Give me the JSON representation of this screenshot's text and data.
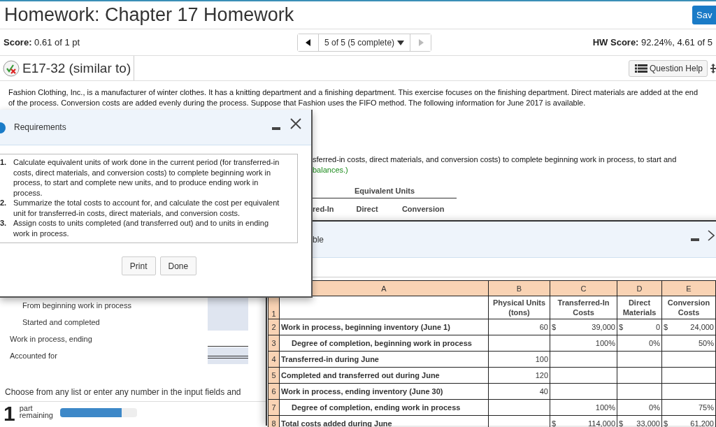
{
  "header": {
    "title": "Homework: Chapter 17 Homework",
    "save_label": "Sav"
  },
  "score_bar": {
    "score_label": "Score:",
    "score_value": "0.61 of 1 pt",
    "nav": {
      "label": "5 of 5 (5 complete)",
      "prev_disabled": false,
      "next_disabled": true
    },
    "hw_label": "HW Score:",
    "hw_value": "92.24%, 4.61 of 5"
  },
  "question_bar": {
    "title": "E17-32 (similar to)",
    "partial_credit": true,
    "help_label": "Question Help"
  },
  "problem_text": "Fashion Clothing, Inc., is a manufacturer of winter clothes. It has a knitting department and a finishing department. This exercise focuses on the finishing department. Direct materials are added at the end of the process. Conversion costs are added evenly during the process. Suppose that Fashion uses the FIFO method. The following information for June 2017 is available.",
  "instructions": {
    "text": "sferred-in costs, direct materials, and conversion costs) to complete beginning work in process, to start and",
    "hint": "balances.)"
  },
  "equivalent_units": {
    "title": "Equivalent Units",
    "columns": [
      "red-In",
      "Direct",
      "Conversion"
    ]
  },
  "worksheet_rows": [
    {
      "label": "From beginning work in process",
      "indent": true,
      "answer_cell": true,
      "underline": false,
      "double_underline": false
    },
    {
      "label": "Started and completed",
      "indent": true,
      "answer_cell": true,
      "underline": false,
      "double_underline": false
    },
    {
      "label": "Work in process, ending",
      "indent": false,
      "answer_cell": false,
      "underline": true,
      "double_underline": false
    },
    {
      "label": "Accounted for",
      "indent": false,
      "answer_cell": true,
      "underline": false,
      "double_underline": true
    }
  ],
  "footer": {
    "instruction": "Choose from any list or enter any number in the input fields and",
    "parts_count": "1",
    "parts_label": "part remaining",
    "progress": {
      "level": 0.8
    }
  },
  "requirements_dialog": {
    "title": "Requirements",
    "items": [
      {
        "number": "1.",
        "text": "Calculate equivalent units of work done in the current period (for transferred-in costs, direct materials, and conversion costs) to complete beginning work in process, to start and complete new units, and to produce ending work in process."
      },
      {
        "number": "2.",
        "text": "Summarize the total costs to account for, and calculate the cost per equivalent unit for transferred-in costs, direct materials, and conversion costs."
      },
      {
        "number": "3.",
        "text": "Assign costs to units completed (and transferred out) and to units in ending work in process."
      }
    ],
    "buttons": [
      "Print",
      "Done"
    ]
  },
  "data_dialog": {
    "title": "ble",
    "table": {
      "column_letters": [
        "A",
        "B",
        "C",
        "D",
        "E"
      ],
      "heading_row": {
        "number": "1",
        "headings": [
          "Physical Units (tons)",
          "Transferred-In Costs",
          "Direct Materials",
          "Conversion Costs"
        ]
      },
      "rows": [
        {
          "number": "2",
          "label": "Work in process, beginning inventory (June 1)",
          "indent": false,
          "cells": [
            {
              "value": "60"
            },
            {
              "currency": "$",
              "value": "39,000"
            },
            {
              "currency": "$",
              "value": "0"
            },
            {
              "currency": "$",
              "value": "24,000"
            }
          ]
        },
        {
          "number": "3",
          "label": "Degree of completion, beginning work in process",
          "indent": true,
          "cells": [
            {},
            {
              "value": "100%"
            },
            {
              "value": "0%"
            },
            {
              "value": "50%"
            }
          ]
        },
        {
          "number": "4",
          "label": "Transferred-in during June",
          "indent": false,
          "cells": [
            {
              "value": "100"
            },
            {},
            {},
            {}
          ]
        },
        {
          "number": "5",
          "label": "Completed and transferred out during June",
          "indent": false,
          "cells": [
            {
              "value": "120"
            },
            {},
            {},
            {}
          ]
        },
        {
          "number": "6",
          "label": "Work in process, ending inventory (June 30)",
          "indent": false,
          "cells": [
            {
              "value": "40"
            },
            {},
            {},
            {}
          ]
        },
        {
          "number": "7",
          "label": "Degree of completion, ending work in process",
          "indent": true,
          "cells": [
            {},
            {
              "value": "100%"
            },
            {
              "value": "0%"
            },
            {
              "value": "75%"
            }
          ]
        },
        {
          "number": "8",
          "label": "Total costs added during June",
          "indent": false,
          "cells": [
            {},
            {
              "currency": "$",
              "value": "114,000"
            },
            {
              "currency": "$",
              "value": "33,000"
            },
            {
              "currency": "$",
              "value": "61,200"
            }
          ]
        }
      ]
    }
  }
}
